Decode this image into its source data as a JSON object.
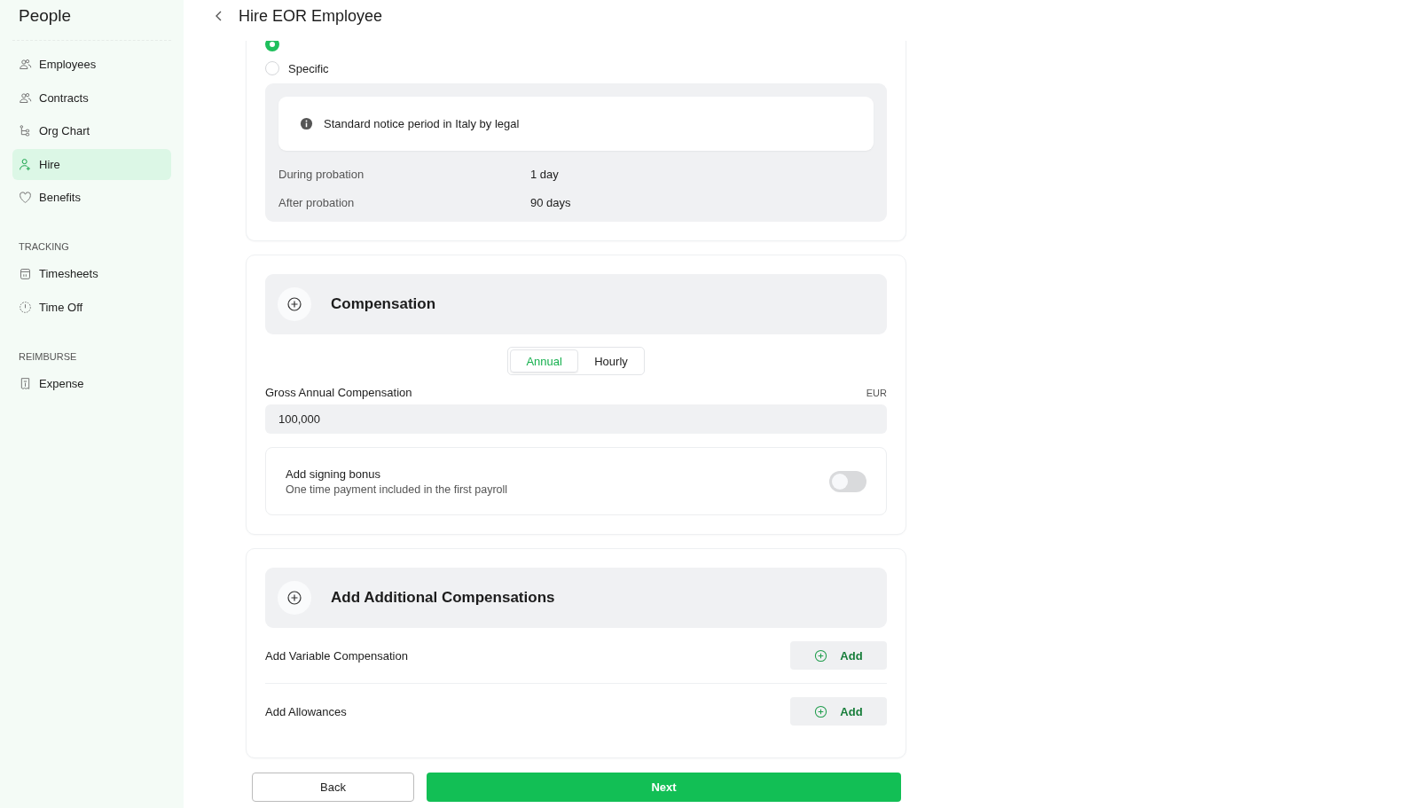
{
  "sidebar": {
    "title": "People",
    "sections": [
      {
        "items": [
          {
            "label": "Employees",
            "kind": "people",
            "selected": false
          },
          {
            "label": "Contracts",
            "kind": "people",
            "selected": false
          },
          {
            "label": "Org Chart",
            "kind": "tree",
            "selected": false
          },
          {
            "label": "Hire",
            "kind": "person-add",
            "selected": true
          },
          {
            "label": "Benefits",
            "kind": "heart",
            "selected": false
          }
        ]
      },
      {
        "heading": "TRACKING",
        "items": [
          {
            "label": "Timesheets",
            "kind": "calendar",
            "selected": false
          },
          {
            "label": "Time Off",
            "kind": "clock",
            "selected": false
          }
        ]
      },
      {
        "heading": "REIMBURSE",
        "items": [
          {
            "label": "Expense",
            "kind": "receipt",
            "selected": false
          }
        ]
      }
    ]
  },
  "header": {
    "title": "Hire EOR Employee"
  },
  "notice": {
    "radios": [
      {
        "selected": true
      },
      {
        "label": "Specific",
        "selected": false
      }
    ],
    "info": "Standard notice period in Italy by legal",
    "rows": [
      {
        "label": "During probation",
        "value": "1 day"
      },
      {
        "label": "After probation",
        "value": "90 days"
      }
    ]
  },
  "compensation": {
    "title": "Compensation",
    "tabs": [
      {
        "label": "Annual",
        "selected": true
      },
      {
        "label": "Hourly",
        "selected": false
      }
    ],
    "field": {
      "label": "Gross Annual Compensation",
      "currency": "EUR",
      "value": "100,000"
    },
    "bonus": {
      "title": "Add signing bonus",
      "description": "One time payment included in the first payroll",
      "on": false
    }
  },
  "additional": {
    "title": "Add Additional Compensations",
    "rows": [
      {
        "label": "Add Variable Compensation",
        "button": "Add"
      },
      {
        "label": "Add Allowances",
        "button": "Add"
      }
    ]
  },
  "footer": {
    "back": "Back",
    "next": "Next"
  }
}
